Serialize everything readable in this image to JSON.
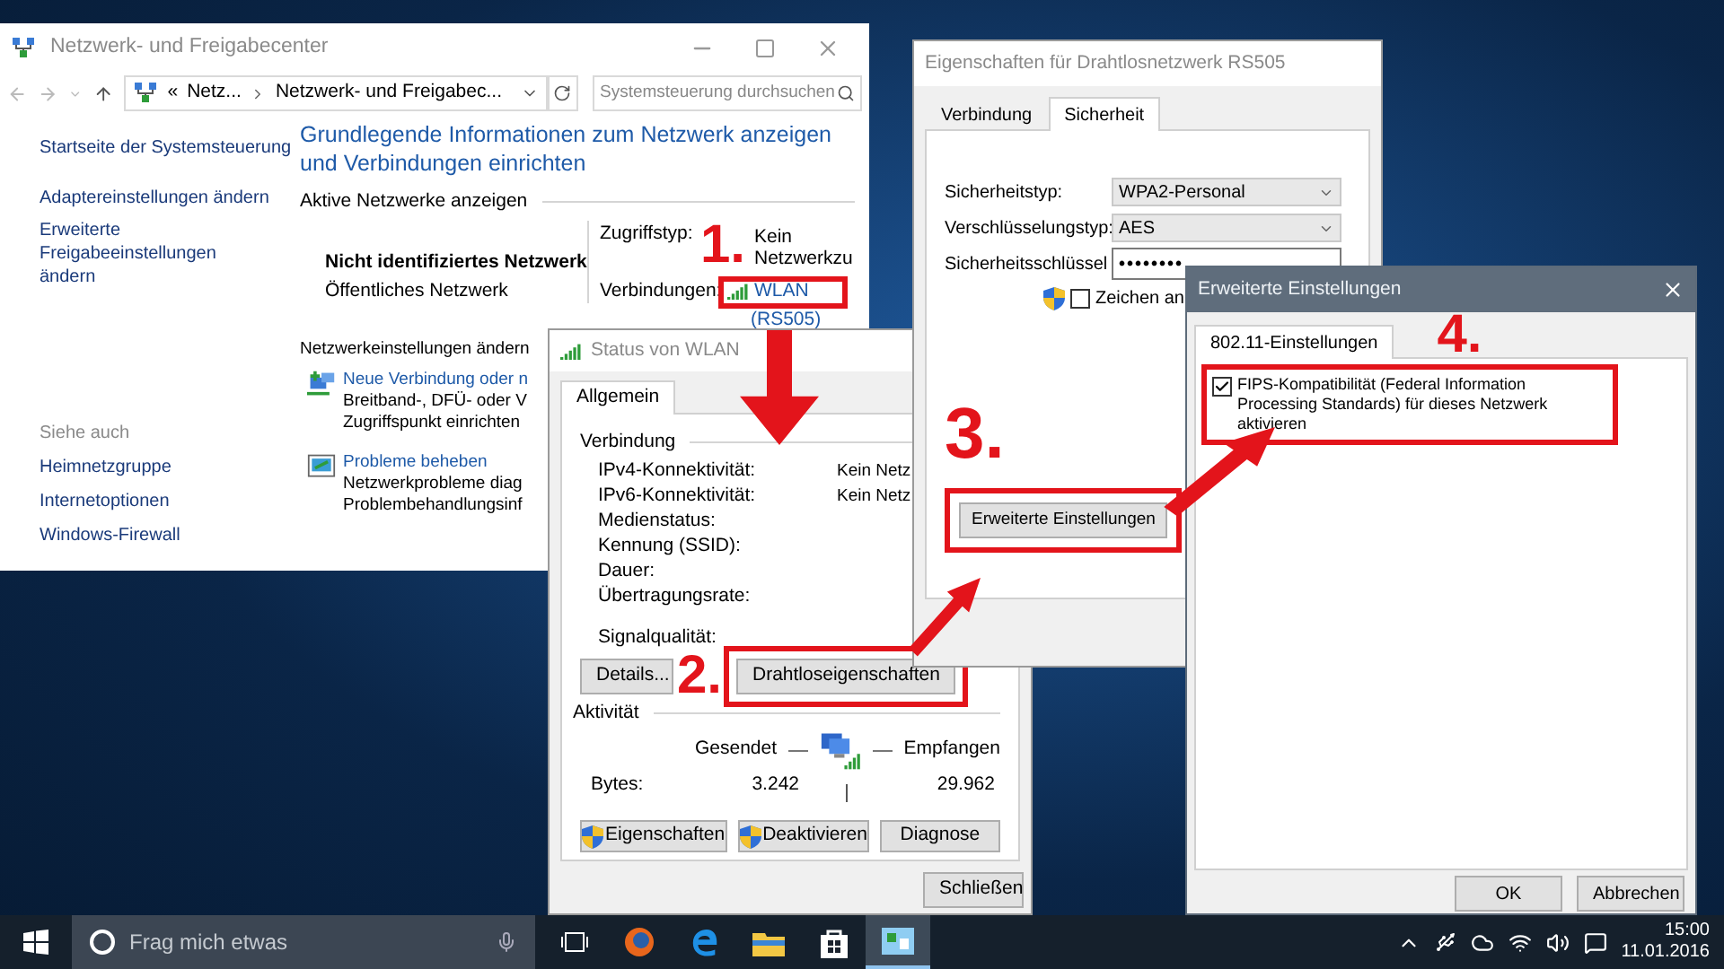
{
  "network_center": {
    "title": "Netzwerk- und Freigabecenter",
    "breadcrumb": [
      "«",
      "Netz...",
      "Netzwerk- und Freigabec..."
    ],
    "search": {
      "placeholder": "Systemsteuerung durchsuchen"
    },
    "sidebar": {
      "links": [
        "Startseite der Systemsteuerung",
        "Adaptereinstellungen ändern",
        "Erweiterte Freigabeeinstellungen ändern"
      ],
      "see_also_heading": "Siehe auch",
      "see_also": [
        "Heimnetzgruppe",
        "Internetoptionen",
        "Windows-Firewall"
      ]
    },
    "heading": "Grundlegende Informationen zum Netzwerk anzeigen und Verbindungen einrichten",
    "active_networks": {
      "section": "Aktive Netzwerke anzeigen",
      "name": "Nicht identifiziertes Netzwerk",
      "category": "Öffentliches Netzwerk",
      "access_label": "Zugriffstyp:",
      "access_value": "Kein Netzwerkzu",
      "connections_label": "Verbindungen:",
      "connection": "WLAN",
      "connection_ssid": "(RS505)"
    },
    "change_settings": {
      "section": "Netzwerkeinstellungen ändern",
      "items": [
        {
          "kind": "new_connection",
          "link": "Neue Verbindung oder n",
          "lines": [
            "Breitband-, DFÜ- oder V",
            "Zugriffspunkt einrichten"
          ]
        },
        {
          "kind": "troubleshoot",
          "link": "Probleme beheben",
          "lines": [
            "Netzwerkprobleme diag",
            "Problembehandlungsinf"
          ]
        }
      ]
    }
  },
  "status_window": {
    "title": "Status von WLAN",
    "tabs": [
      {
        "label": "Allgemein",
        "selected": true
      }
    ],
    "connection_section": "Verbindung",
    "rows": [
      {
        "label": "IPv4-Konnektivität:",
        "value": "Kein Netz"
      },
      {
        "label": "IPv6-Konnektivität:",
        "value": "Kein Netz"
      },
      {
        "label": "Medienstatus:"
      },
      {
        "label": "Kennung (SSID):"
      },
      {
        "label": "Dauer:"
      },
      {
        "label": "Übertragungsrate:"
      }
    ],
    "signal_label": "Signalqualität:",
    "details_button": "Details...",
    "wireless_button": "Drahtloseigenschaften",
    "activity": {
      "section": "Aktivität",
      "sent": "Gesendet",
      "received": "Empfangen",
      "bytes_label": "Bytes:",
      "sent_bytes": "3.242",
      "received_bytes": "29.962"
    },
    "actions": [
      {
        "label": "Eigenschaften",
        "shield": true
      },
      {
        "label": "Deaktivieren",
        "shield": true
      },
      {
        "label": "Diagnose",
        "shield": false
      }
    ],
    "close_button": "Schließen"
  },
  "properties_window": {
    "title": "Eigenschaften für Drahtlosnetzwerk RS505",
    "tabs": [
      {
        "label": "Verbindung",
        "selected": false
      },
      {
        "label": "Sicherheit",
        "selected": true
      }
    ],
    "fields": [
      {
        "kind": "select",
        "label": "Sicherheitstyp:",
        "value": "WPA2-Personal"
      },
      {
        "kind": "select",
        "label": "Verschlüsselungstyp:",
        "value": "AES"
      },
      {
        "kind": "password",
        "label": "Sicherheitsschlüssel",
        "value": "••••••••"
      }
    ],
    "show_chars": {
      "label": "Zeichen an",
      "checked": false
    },
    "advanced_button": "Erweiterte Einstellungen"
  },
  "advanced_window": {
    "title": "Erweiterte Einstellungen",
    "tabs": [
      {
        "label": "802.11-Einstellungen",
        "selected": true
      }
    ],
    "fips": {
      "label": "FIPS-Kompatibilität (Federal Information Processing Standards) für dieses Netzwerk aktivieren",
      "checked": true
    },
    "buttons": [
      "OK",
      "Abbrechen"
    ]
  },
  "annotations": [
    "1.",
    "2.",
    "3.",
    "4."
  ],
  "taskbar": {
    "search": {
      "placeholder": "Frag mich etwas"
    },
    "apps": [
      {
        "kind": "task_view",
        "active": false
      },
      {
        "kind": "firefox",
        "active": false
      },
      {
        "kind": "edge",
        "active": false
      },
      {
        "kind": "explorer",
        "active": false
      },
      {
        "kind": "store",
        "active": false
      },
      {
        "kind": "control_panel",
        "active": true
      }
    ],
    "time": "15:00",
    "date": "11.01.2016"
  }
}
